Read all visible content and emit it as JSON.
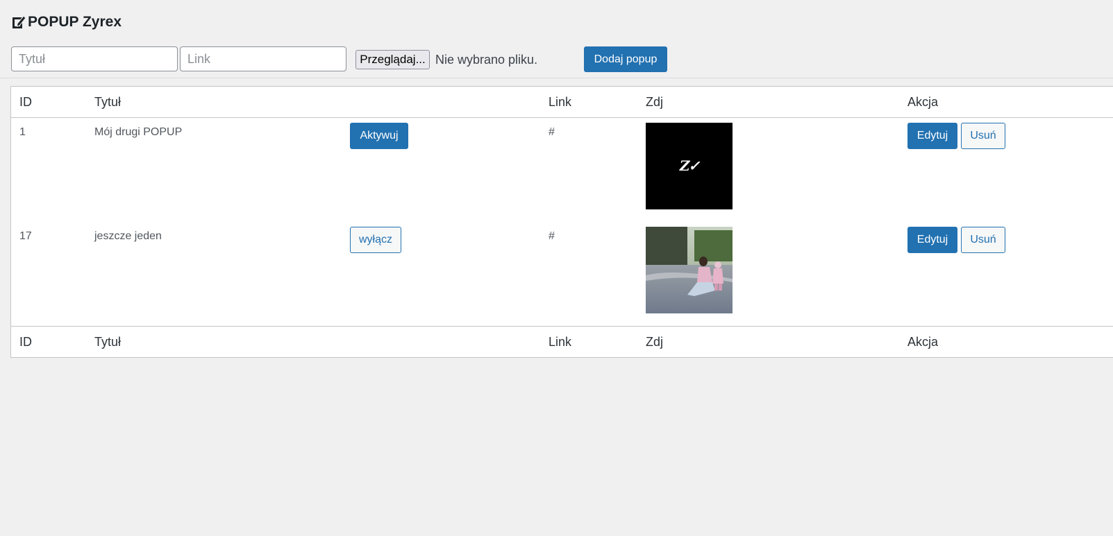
{
  "header": {
    "title": "POPUP Zyrex",
    "icon": "edit-page-icon"
  },
  "form": {
    "title_placeholder": "Tytuł",
    "link_placeholder": "Link",
    "browse_label": "Przeglądaj...",
    "no_file_text": "Nie wybrano pliku.",
    "add_label": "Dodaj popup"
  },
  "table": {
    "columns": {
      "id": "ID",
      "title": "Tytuł",
      "link": "Link",
      "image": "Zdj",
      "action": "Akcja"
    },
    "rows": [
      {
        "id": "1",
        "title": "Mój drugi POPUP",
        "toggle_label": "Aktywuj",
        "link": "#",
        "image_text": "Z✓",
        "edit_label": "Edytuj",
        "delete_label": "Usuń"
      },
      {
        "id": "17",
        "title": "jeszcze jeden",
        "toggle_label": "wyłącz",
        "link": "#",
        "edit_label": "Edytuj",
        "delete_label": "Usuń"
      }
    ]
  },
  "colors": {
    "primary": "#2271b1",
    "background": "#f0f0f1"
  }
}
